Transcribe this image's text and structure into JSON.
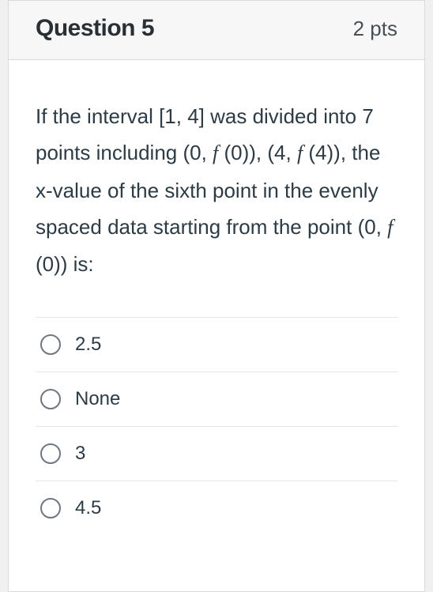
{
  "header": {
    "title": "Question 5",
    "points": "2 pts"
  },
  "stem": {
    "p1": "If the interval [1, 4] was divided into 7 points including (0, ",
    "f1": "f",
    "p2": " (0)), (4, ",
    "f2": "f",
    "p3": " (4)), the x-value of the sixth point in the evenly spaced data starting from the point (0, ",
    "f3": "f",
    "p4": " (0)) is:"
  },
  "options": [
    {
      "label": "2.5"
    },
    {
      "label": "None"
    },
    {
      "label": "3"
    },
    {
      "label": "4.5"
    }
  ]
}
